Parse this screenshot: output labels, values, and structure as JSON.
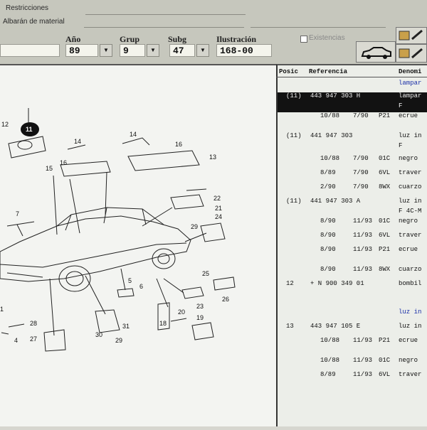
{
  "header": {
    "restricciones_label": "Restricciones",
    "albaran_label": "Albarán de material",
    "anio_label": "Año",
    "grup_label": "Grup",
    "subg_label": "Subg",
    "ilustracion_label": "Ilustración",
    "anio_value": "89",
    "grup_value": "9",
    "subg_value": "47",
    "ilustracion_value": "168-00",
    "existencias_label": "Existencias",
    "dropdown_glyph": "▼"
  },
  "table": {
    "col_pos": "Posic",
    "col_ref": "Referencia",
    "col_den": "Denomi",
    "rows": [
      {
        "pos": "",
        "ref": "",
        "date": "",
        "code": "",
        "den": "lampar",
        "style": "blue"
      },
      {
        "pos": "(11)",
        "ref": "443 947 303 H",
        "date": "",
        "code": "",
        "den": "lampar",
        "style": "sel"
      },
      {
        "pos": "",
        "ref": "",
        "date": "",
        "code": "",
        "den": "F",
        "style": "sel"
      },
      {
        "pos": "",
        "ref": "10/88",
        "date": "7/90",
        "code": "P21",
        "den": "ecrue",
        "style": ""
      },
      {
        "pos": "(11)",
        "ref": "441 947 303",
        "date": "",
        "code": "",
        "den": "luz in",
        "style": ""
      },
      {
        "pos": "",
        "ref": "",
        "date": "",
        "code": "",
        "den": "F",
        "style": ""
      },
      {
        "pos": "",
        "ref": "10/88",
        "date": "7/90",
        "code": "01C",
        "den": "negro",
        "style": ""
      },
      {
        "pos": "",
        "ref": "8/89",
        "date": "7/90",
        "code": "6VL",
        "den": "traver",
        "style": ""
      },
      {
        "pos": "",
        "ref": "2/90",
        "date": "7/90",
        "code": "8WX",
        "den": "cuarzo",
        "style": ""
      },
      {
        "pos": "(11)",
        "ref": "441 947 303 A",
        "date": "",
        "code": "",
        "den": "luz in",
        "style": ""
      },
      {
        "pos": "",
        "ref": "",
        "date": "",
        "code": "",
        "den": "F 4C-M",
        "style": ""
      },
      {
        "pos": "",
        "ref": "8/90",
        "date": "11/93",
        "code": "01C",
        "den": "negro",
        "style": ""
      },
      {
        "pos": "",
        "ref": "8/90",
        "date": "11/93",
        "code": "6VL",
        "den": "traver",
        "style": ""
      },
      {
        "pos": "",
        "ref": "8/90",
        "date": "11/93",
        "code": "P21",
        "den": "ecrue",
        "style": ""
      },
      {
        "pos": "",
        "ref": "8/90",
        "date": "11/93",
        "code": "8WX",
        "den": "cuarzo",
        "style": ""
      },
      {
        "pos": "12",
        "ref": "+ N   900 349 01",
        "date": "",
        "code": "",
        "den": "bombil",
        "style": ""
      },
      {
        "pos": "",
        "ref": "",
        "date": "",
        "code": "",
        "den": "luz in",
        "style": "blue"
      },
      {
        "pos": "13",
        "ref": "443 947 105 E",
        "date": "",
        "code": "",
        "den": "luz in",
        "style": ""
      },
      {
        "pos": "",
        "ref": "10/88",
        "date": "11/93",
        "code": "P21",
        "den": "ecrue",
        "style": ""
      },
      {
        "pos": "",
        "ref": "10/88",
        "date": "11/93",
        "code": "01C",
        "den": "negro",
        "style": ""
      },
      {
        "pos": "",
        "ref": "8/89",
        "date": "11/93",
        "code": "6VL",
        "den": "traver",
        "style": ""
      }
    ]
  },
  "diagram_callouts": [
    "12",
    "11",
    "14",
    "14",
    "16",
    "16",
    "13",
    "15",
    "22",
    "21",
    "24",
    "7",
    "29",
    "5",
    "6",
    "25",
    "23",
    "26",
    "18",
    "20",
    "19",
    "28",
    "27",
    "4",
    "30",
    "31",
    "29",
    "1"
  ]
}
